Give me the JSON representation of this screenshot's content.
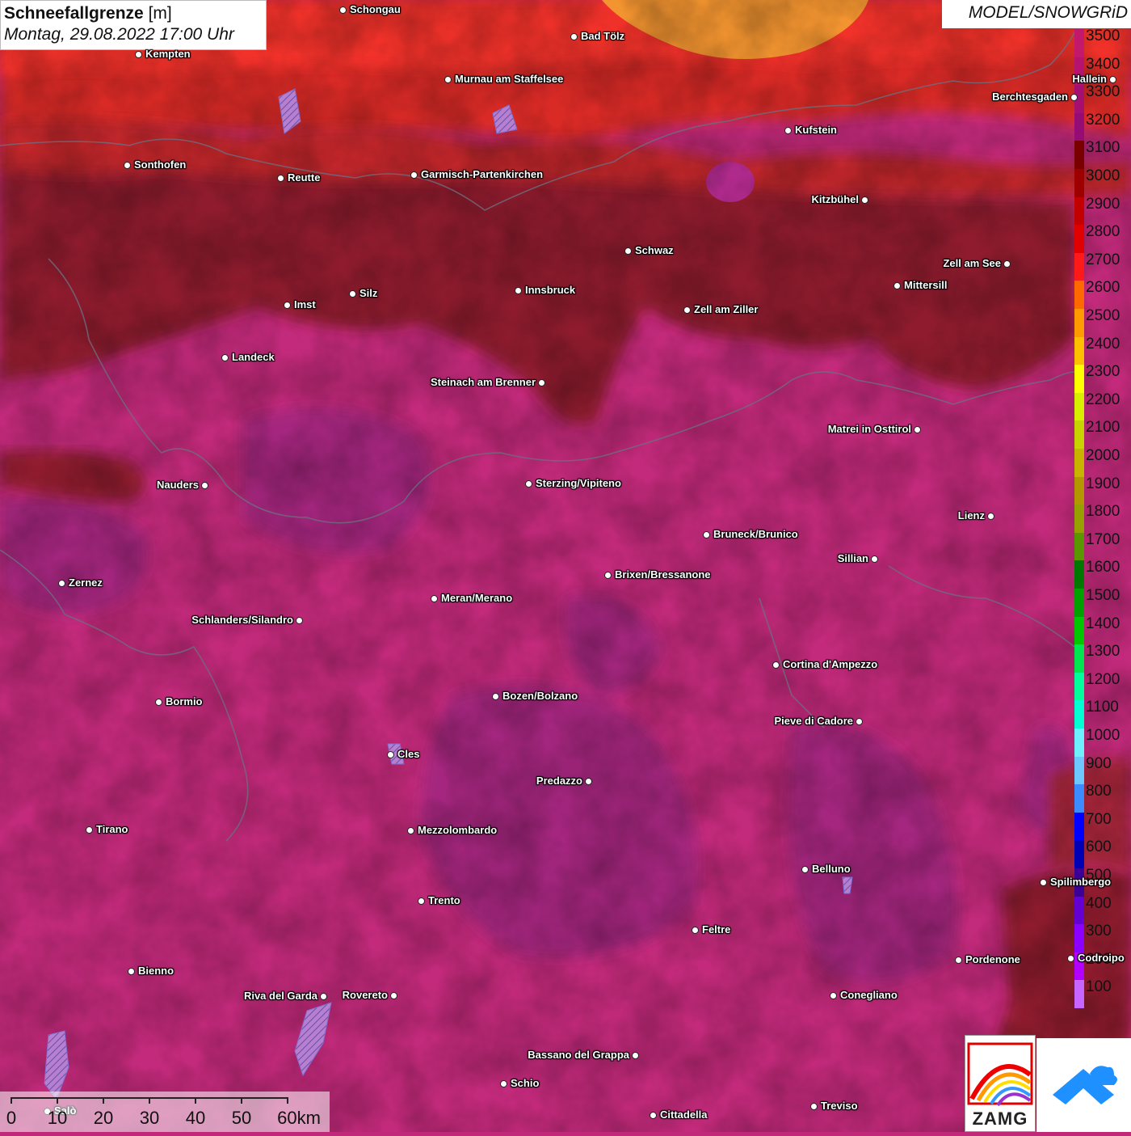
{
  "header": {
    "title": "Schneefallgrenze",
    "unit": "[m]",
    "datetime": "Montag, 29.08.2022 17:00 Uhr",
    "model": "MODEL/SNOWGRiD"
  },
  "legend": {
    "steps": [
      {
        "label": "3500",
        "color": "#c4186c"
      },
      {
        "label": "3400",
        "color": "#b5136f"
      },
      {
        "label": "3300",
        "color": "#a60f72"
      },
      {
        "label": "3200",
        "color": "#950c74"
      },
      {
        "label": "3100",
        "color": "#7a0000"
      },
      {
        "label": "3000",
        "color": "#9e0000"
      },
      {
        "label": "2900",
        "color": "#c20000"
      },
      {
        "label": "2800",
        "color": "#e00000"
      },
      {
        "label": "2700",
        "color": "#ff1a1a"
      },
      {
        "label": "2600",
        "color": "#ff6a00"
      },
      {
        "label": "2500",
        "color": "#ff9a00"
      },
      {
        "label": "2400",
        "color": "#ffc000"
      },
      {
        "label": "2300",
        "color": "#ffff00"
      },
      {
        "label": "2200",
        "color": "#d8f000"
      },
      {
        "label": "2100",
        "color": "#c8d400"
      },
      {
        "label": "2000",
        "color": "#c8b400"
      },
      {
        "label": "1900",
        "color": "#b49600"
      },
      {
        "label": "1800",
        "color": "#96a000"
      },
      {
        "label": "1700",
        "color": "#5a9600"
      },
      {
        "label": "1600",
        "color": "#007800"
      },
      {
        "label": "1500",
        "color": "#00a000"
      },
      {
        "label": "1400",
        "color": "#00c800"
      },
      {
        "label": "1300",
        "color": "#00e650"
      },
      {
        "label": "1200",
        "color": "#00ff9a"
      },
      {
        "label": "1100",
        "color": "#00ffd2"
      },
      {
        "label": "1000",
        "color": "#6ef0ff"
      },
      {
        "label": "900",
        "color": "#6ec8ff"
      },
      {
        "label": "800",
        "color": "#3c8cff"
      },
      {
        "label": "700",
        "color": "#0000ff"
      },
      {
        "label": "600",
        "color": "#0000b4"
      },
      {
        "label": "500",
        "color": "#3c0096"
      },
      {
        "label": "400",
        "color": "#6400d2"
      },
      {
        "label": "300",
        "color": "#8c00ff"
      },
      {
        "label": "200",
        "color": "#b400ff"
      },
      {
        "label": "100",
        "color": "#c864ff"
      }
    ]
  },
  "scale_bar": {
    "labels": [
      "0",
      "10",
      "20",
      "30",
      "40",
      "50",
      "60km"
    ]
  },
  "logos": {
    "zamg_text": "ZAMG"
  },
  "cities": [
    {
      "name": "Schongau",
      "side": "right"
    },
    {
      "name": "Bad Tölz",
      "side": "right"
    },
    {
      "name": "Kempten",
      "side": "right"
    },
    {
      "name": "Murnau am Staffelsee",
      "side": "right"
    },
    {
      "name": "Hallein",
      "side": "left"
    },
    {
      "name": "Berchtesgaden",
      "side": "left"
    },
    {
      "name": "Kufstein",
      "side": "right"
    },
    {
      "name": "Sonthofen",
      "side": "right"
    },
    {
      "name": "Reutte",
      "side": "right"
    },
    {
      "name": "Garmisch-Partenkirchen",
      "side": "right"
    },
    {
      "name": "Kitzbühel",
      "side": "left"
    },
    {
      "name": "Schwaz",
      "side": "right"
    },
    {
      "name": "Zell am See",
      "side": "left"
    },
    {
      "name": "Mittersill",
      "side": "right"
    },
    {
      "name": "Innsbruck",
      "side": "right"
    },
    {
      "name": "Silz",
      "side": "right"
    },
    {
      "name": "Imst",
      "side": "right"
    },
    {
      "name": "Zell am Ziller",
      "side": "right"
    },
    {
      "name": "Landeck",
      "side": "right"
    },
    {
      "name": "Steinach am Brenner",
      "side": "left"
    },
    {
      "name": "Matrei in Osttirol",
      "side": "left"
    },
    {
      "name": "Nauders",
      "side": "left"
    },
    {
      "name": "Sterzing/Vipiteno",
      "side": "right"
    },
    {
      "name": "Lienz",
      "side": "left"
    },
    {
      "name": "Bruneck/Brunico",
      "side": "right"
    },
    {
      "name": "Sillian",
      "side": "left"
    },
    {
      "name": "Zernez",
      "side": "right"
    },
    {
      "name": "Brixen/Bressanone",
      "side": "right"
    },
    {
      "name": "Meran/Merano",
      "side": "right"
    },
    {
      "name": "Schlanders/Silandro",
      "side": "left"
    },
    {
      "name": "Cortina d'Ampezzo",
      "side": "right"
    },
    {
      "name": "Bozen/Bolzano",
      "side": "right"
    },
    {
      "name": "Bormio",
      "side": "right"
    },
    {
      "name": "Pieve di Cadore",
      "side": "left"
    },
    {
      "name": "Cles",
      "side": "right"
    },
    {
      "name": "Predazzo",
      "side": "left"
    },
    {
      "name": "Tirano",
      "side": "right"
    },
    {
      "name": "Mezzolombardo",
      "side": "right"
    },
    {
      "name": "Belluno",
      "side": "right"
    },
    {
      "name": "Spilimbergo",
      "side": "right"
    },
    {
      "name": "Trento",
      "side": "right"
    },
    {
      "name": "Feltre",
      "side": "right"
    },
    {
      "name": "Pordenone",
      "side": "right"
    },
    {
      "name": "Codroipo",
      "side": "right"
    },
    {
      "name": "Bienno",
      "side": "right"
    },
    {
      "name": "Riva del Garda",
      "side": "left"
    },
    {
      "name": "Rovereto",
      "side": "left"
    },
    {
      "name": "Conegliano",
      "side": "right"
    },
    {
      "name": "Bassano del Grappa",
      "side": "left"
    },
    {
      "name": "Schio",
      "side": "right"
    },
    {
      "name": "Salò",
      "side": "right"
    },
    {
      "name": "Treviso",
      "side": "right"
    },
    {
      "name": "Cittadella",
      "side": "right"
    }
  ]
}
